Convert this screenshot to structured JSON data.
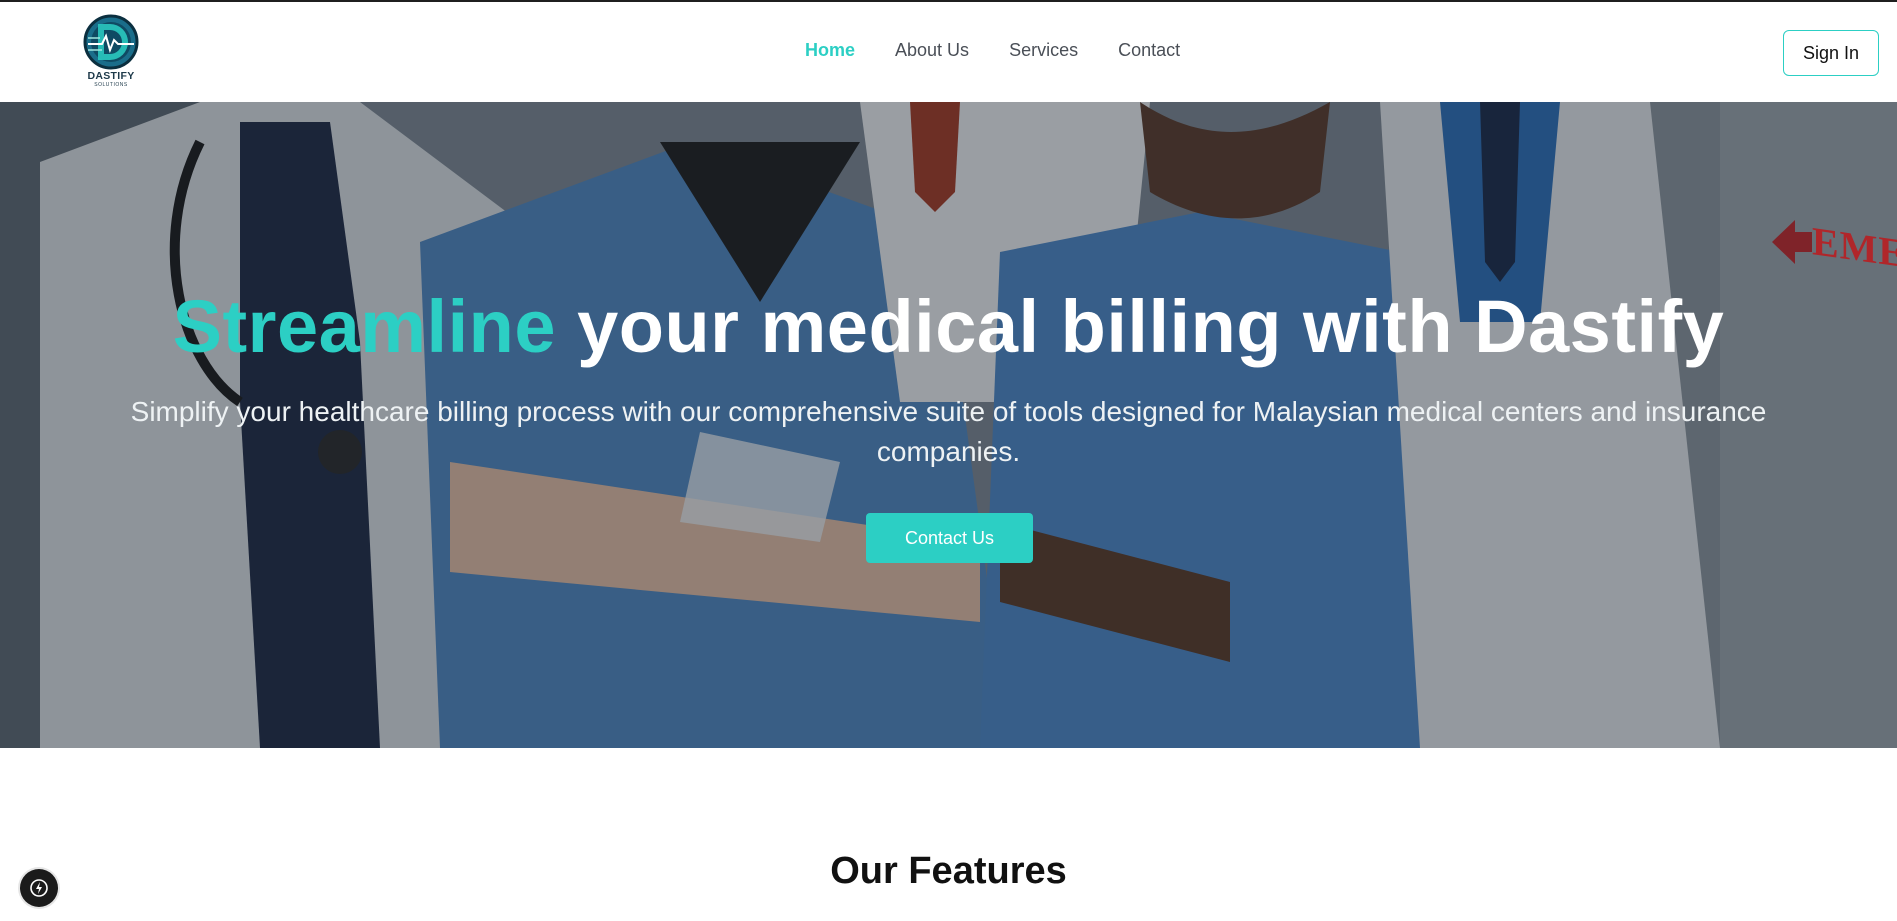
{
  "brand": {
    "name": "DASTIFY",
    "tagline": "SOLUTIONS"
  },
  "nav": {
    "items": [
      {
        "label": "Home",
        "active": true
      },
      {
        "label": "About Us",
        "active": false
      },
      {
        "label": "Services",
        "active": false
      },
      {
        "label": "Contact",
        "active": false
      }
    ],
    "signin_label": "Sign In"
  },
  "hero": {
    "title_accent": "Streamline",
    "title_rest": " your medical billing with Dastify",
    "subtitle": "Simplify your healthcare billing process with our comprehensive suite of tools designed for Malaysian medical centers and insurance companies.",
    "cta_label": "Contact Us",
    "sign_text": "EMERGE"
  },
  "features": {
    "title": "Our Features"
  },
  "colors": {
    "accent": "#2ccfc4",
    "nav_text": "#4a4f57",
    "dark": "#1b1b1b"
  },
  "icons": {
    "fab": "lightning-icon"
  }
}
